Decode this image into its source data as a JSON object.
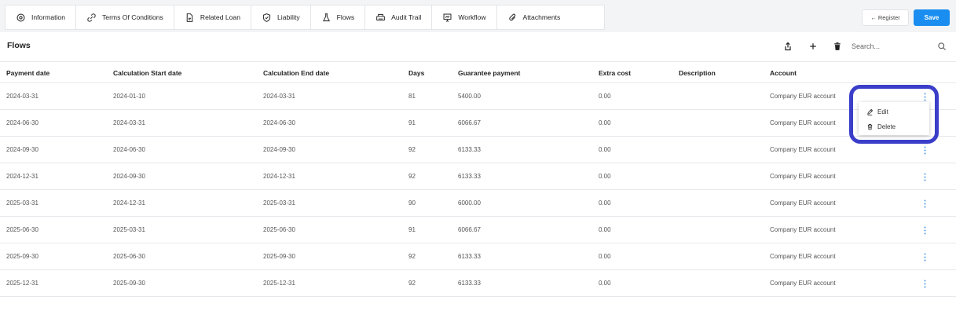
{
  "tabs": [
    {
      "label": "Information",
      "icon": "gear-icon"
    },
    {
      "label": "Terms Of Conditions",
      "icon": "link-icon"
    },
    {
      "label": "Related Loan",
      "icon": "document-icon"
    },
    {
      "label": "Liability",
      "icon": "shield-icon"
    },
    {
      "label": "Flows",
      "icon": "flask-icon"
    },
    {
      "label": "Audit Trail",
      "icon": "printer-icon"
    },
    {
      "label": "Workflow",
      "icon": "presentation-icon"
    },
    {
      "label": "Attachments",
      "icon": "paperclip-icon"
    }
  ],
  "header_actions": {
    "register_label": "← Register",
    "save_label": "Save",
    "save_color": "#1a8ef0"
  },
  "section": {
    "title": "Flows",
    "toolbar_icons": [
      "share-icon",
      "plus-icon",
      "trash-icon",
      "search-icon"
    ],
    "search_placeholder": "Search..."
  },
  "table": {
    "columns": [
      "Payment date",
      "Calculation Start date",
      "Calculation End date",
      "Days",
      "Guarantee payment",
      "Extra cost",
      "Description",
      "Account"
    ],
    "rows": [
      [
        "2024-03-31",
        "2024-01-10",
        "2024-03-31",
        "81",
        "5400.00",
        "0.00",
        "",
        "Company EUR account"
      ],
      [
        "2024-06-30",
        "2024-03-31",
        "2024-06-30",
        "91",
        "6066.67",
        "0.00",
        "",
        "Company EUR account"
      ],
      [
        "2024-09-30",
        "2024-06-30",
        "2024-09-30",
        "92",
        "6133.33",
        "0.00",
        "",
        "Company EUR account"
      ],
      [
        "2024-12-31",
        "2024-09-30",
        "2024-12-31",
        "92",
        "6133.33",
        "0.00",
        "",
        "Company EUR account"
      ],
      [
        "2025-03-31",
        "2024-12-31",
        "2025-03-31",
        "90",
        "6000.00",
        "0.00",
        "",
        "Company EUR account"
      ],
      [
        "2025-06-30",
        "2025-03-31",
        "2025-06-30",
        "91",
        "6066.67",
        "0.00",
        "",
        "Company EUR account"
      ],
      [
        "2025-09-30",
        "2025-06-30",
        "2025-09-30",
        "92",
        "6133.33",
        "0.00",
        "",
        "Company EUR account"
      ],
      [
        "2025-12-31",
        "2025-09-30",
        "2025-12-31",
        "92",
        "6133.33",
        "0.00",
        "",
        "Company EUR account"
      ]
    ]
  },
  "row_menu": {
    "items": [
      {
        "label": "Edit",
        "icon": "edit-icon"
      },
      {
        "label": "Delete",
        "icon": "trash-icon"
      }
    ],
    "highlight_color": "#3a3ec9"
  }
}
